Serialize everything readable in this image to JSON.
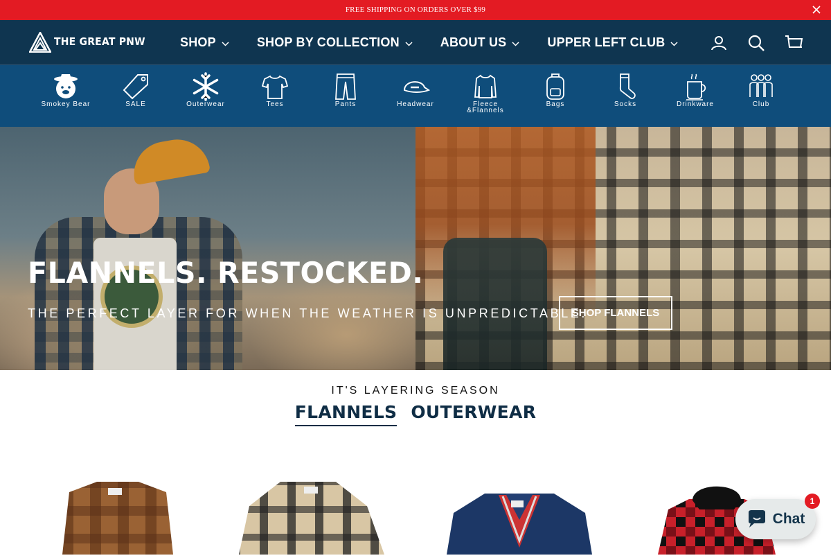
{
  "announcement": {
    "text": "FREE SHIPPING ON ORDERS OVER $99",
    "close_icon": "close-icon"
  },
  "header": {
    "logo_text": "THE GREAT PNW",
    "nav": [
      {
        "label": "SHOP"
      },
      {
        "label": "SHOP BY COLLECTION"
      },
      {
        "label": "ABOUT US"
      },
      {
        "label": "UPPER LEFT CLUB"
      }
    ],
    "icons": [
      "account-icon",
      "search-icon",
      "cart-icon"
    ]
  },
  "categories": [
    {
      "label": "Smokey Bear",
      "icon": "smokey-bear-icon"
    },
    {
      "label": "SALE",
      "icon": "tag-icon"
    },
    {
      "label": "Outerwear",
      "icon": "snowflake-icon"
    },
    {
      "label": "Tees",
      "icon": "tshirt-icon"
    },
    {
      "label": "Pants",
      "icon": "pants-icon"
    },
    {
      "label": "Headwear",
      "icon": "cap-icon"
    },
    {
      "label": "Fleece\n&Flannels",
      "line1": "Fleece",
      "line2": "&Flannels",
      "icon": "sweatshirt-icon"
    },
    {
      "label": "Bags",
      "icon": "backpack-icon"
    },
    {
      "label": "Socks",
      "icon": "sock-icon"
    },
    {
      "label": "Drinkware",
      "icon": "mug-icon"
    },
    {
      "label": "Club",
      "icon": "group-icon"
    }
  ],
  "hero": {
    "title": "FLANNELS. RESTOCKED.",
    "subtitle": "THE PERFECT LAYER FOR WHEN THE WEATHER IS UNPREDICTABLE.",
    "button": "SHOP FLANNELS"
  },
  "collection": {
    "eyebrow": "IT'S LAYERING SEASON",
    "tabs": [
      {
        "label": "FLANNELS",
        "active": true
      },
      {
        "label": "OUTERWEAR",
        "active": false
      }
    ]
  },
  "chat": {
    "label": "Chat",
    "badge": "1"
  },
  "colors": {
    "announce": "#e31b23",
    "header": "#0f3550",
    "categories": "#0f4d7b",
    "text_dark": "#0f2d45"
  }
}
